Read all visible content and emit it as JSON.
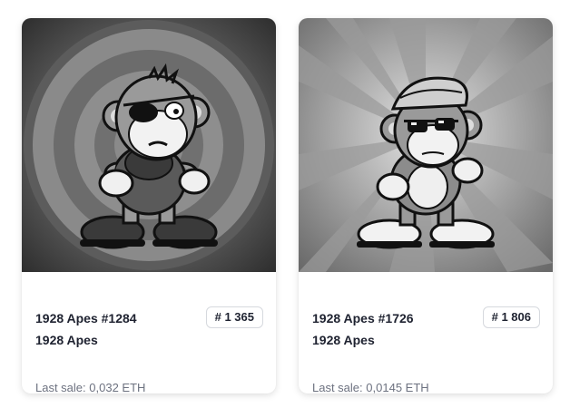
{
  "cards": [
    {
      "title": "1928 Apes #1284",
      "collection": "1928 Apes",
      "rank": "# 1 365",
      "last_sale_label": "Last sale:",
      "last_sale_value": "0,032 ETH",
      "image": "cartoon-ape-eyepatch-art"
    },
    {
      "title": "1928 Apes #1726",
      "collection": "1928 Apes",
      "rank": "# 1 806",
      "last_sale_label": "Last sale:",
      "last_sale_value": "0,0145 ETH",
      "image": "cartoon-ape-sunglasses-cap-art"
    }
  ]
}
